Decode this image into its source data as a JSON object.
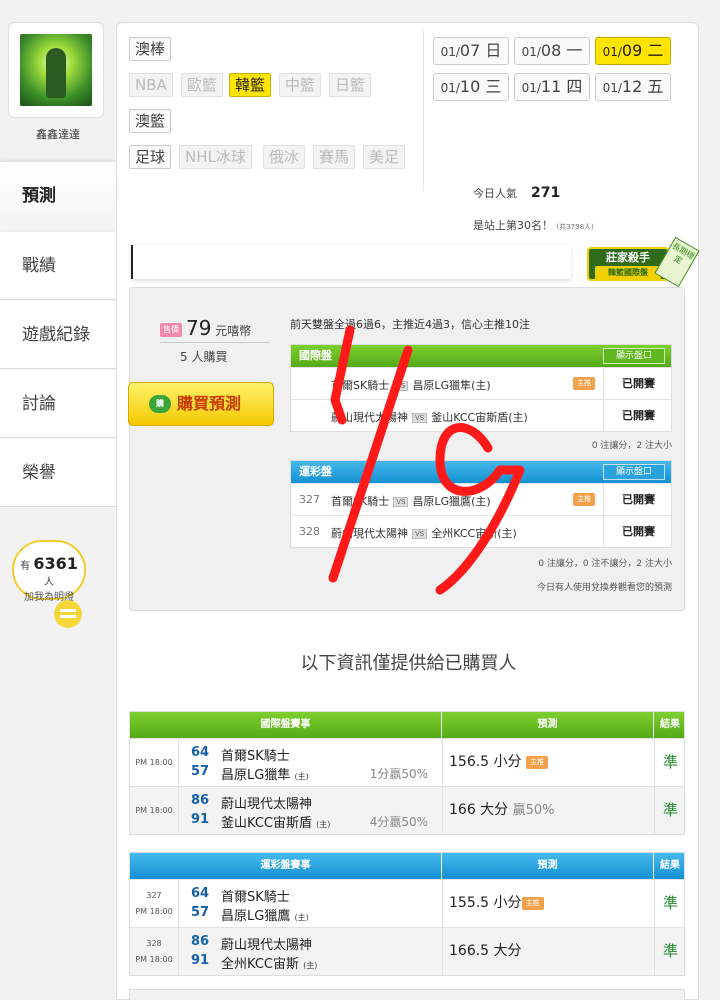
{
  "user": {
    "name": "鑫鑫達達"
  },
  "nav": [
    {
      "label": "預測",
      "active": true
    },
    {
      "label": "戰績"
    },
    {
      "label": "遊戲紀錄"
    },
    {
      "label": "討論"
    },
    {
      "label": "榮譽"
    }
  ],
  "fans": {
    "prefix": "有",
    "count": "6361",
    "unit": "人",
    "sub": "加我為明燈"
  },
  "categories": {
    "australia_baseball": "澳棒",
    "nba": "NBA",
    "euro_bb": "歐籃",
    "korea_bb": "韓籃",
    "china_bb": "中籃",
    "japan_bb": "日籃",
    "australia_bb": "澳籃",
    "football": "足球",
    "nhl": "NHL冰球",
    "russia_ice": "俄冰",
    "horse": "賽馬",
    "us_football": "美足"
  },
  "dates": [
    {
      "md": "01/",
      "d": "07",
      "wd": "日"
    },
    {
      "md": "01/",
      "d": "08",
      "wd": "一"
    },
    {
      "md": "01/",
      "d": "09",
      "wd": "二",
      "selected": true
    },
    {
      "md": "01/",
      "d": "10",
      "wd": "三"
    },
    {
      "md": "01/",
      "d": "11",
      "wd": "四"
    },
    {
      "md": "01/",
      "d": "12",
      "wd": "五"
    }
  ],
  "stats": {
    "popularity_label": "今日人氣",
    "popularity": "271",
    "rank_text": "是站上第30名！",
    "rank_small": "(共3798人)"
  },
  "badge": {
    "title": "莊家殺手",
    "sub": "韓籃國際盤",
    "tag": "長期穩定"
  },
  "prediction": {
    "price_badge": "售價",
    "price": "79",
    "price_unit": "元嘻幣",
    "buyers": "5 人購買",
    "buy_label": "購買預測",
    "buy_icon": "購",
    "summary": "前天雙盤全過6過6，主推近4過3，信心主推10注"
  },
  "intl_table": {
    "title": "國際盤",
    "show_label": "顯示盤口",
    "rows": [
      {
        "num": "",
        "home": "首爾SK騎士",
        "vs": "VS",
        "away": "昌原LG獵隼(主)",
        "host": "主推",
        "status": "已開賽"
      },
      {
        "num": "",
        "home": "蔚山現代太陽神",
        "vs": "VS",
        "away": "釜山KCC宙斯盾(主)",
        "host": "",
        "status": "已開賽"
      }
    ],
    "note": "0 注讓分，2 注大小"
  },
  "lottery_table": {
    "title": "運彩盤",
    "show_label": "顯示盤口",
    "rows": [
      {
        "num": "327",
        "home": "首爾SK騎士",
        "vs": "VS",
        "away": "昌原LG獵鷹(主)",
        "host": "主推",
        "status": "已開賽"
      },
      {
        "num": "328",
        "home": "蔚山現代太陽神",
        "vs": "VS",
        "away": "全州KCC宙斯(主)",
        "host": "",
        "status": "已開賽"
      }
    ],
    "note": "0 注讓分，0 注不讓分，2 注大小",
    "note2": "今日有人使用兌換券觀看您的預測"
  },
  "info_title": "以下資訊僅提供給已購買人",
  "intl_results": {
    "headers": [
      "國際盤賽事",
      "預測",
      "結果"
    ],
    "rows": [
      {
        "time": "PM 18:00",
        "s1": "64",
        "t1": "首爾SK騎士",
        "s2": "57",
        "t2": "昌原LG獵隼",
        "host": "(主)",
        "win": "1分贏50%",
        "pick": "156.5 小分",
        "zhu": "主推",
        "ratio": "",
        "result": "準"
      },
      {
        "time": "PM 18:00",
        "s1": "86",
        "t1": "蔚山現代太陽神",
        "s2": "91",
        "t2": "釜山KCC宙斯盾",
        "host": "(主)",
        "win": "4分贏50%",
        "pick": "166 大分",
        "zhu": "",
        "ratio": "贏50%",
        "result": "準"
      }
    ]
  },
  "lottery_results": {
    "headers": [
      "運彩盤賽事",
      "預測",
      "結果"
    ],
    "rows": [
      {
        "num": "327",
        "time": "PM 18:00",
        "s1": "64",
        "t1": "首爾SK騎士",
        "s2": "57",
        "t2": "昌原LG獵鷹",
        "host": "(主)",
        "pick": "155.5 小分",
        "zhu": "主推",
        "result": "準"
      },
      {
        "num": "328",
        "time": "PM 18:00",
        "s1": "86",
        "t1": "蔚山現代太陽神",
        "s2": "91",
        "t2": "全州KCC宙斯",
        "host": "(主)",
        "pick": "166.5 大分",
        "zhu": "",
        "result": "準"
      }
    ]
  },
  "colors": {
    "accent_yellow": "#ffe400",
    "green_header": "#55aa17",
    "blue_header": "#1491d2",
    "result_green": "#1b8c2a",
    "scribble_red": "#ff1a1a"
  }
}
